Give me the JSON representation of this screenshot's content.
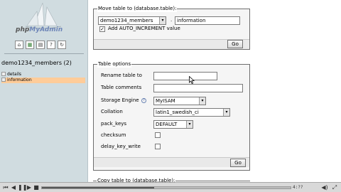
{
  "left_nav": {
    "logo_text_a": "php",
    "logo_text_b": "MyAdmin",
    "nav_icons": [
      "home-icon",
      "query-icon",
      "sql-icon",
      "docs-icon",
      "reload-icon"
    ],
    "database_title": "demo1234_members (2)",
    "tables": [
      {
        "name": "details",
        "selected": false
      },
      {
        "name": "information",
        "selected": true
      }
    ]
  },
  "move_table": {
    "legend": "Move table to (database.table):",
    "database_select": "demo1234_members",
    "separator": ".",
    "table_input": "information",
    "auto_increment_checked": true,
    "auto_increment_label": "Add AUTO_INCREMENT value",
    "go_label": "Go"
  },
  "table_options": {
    "legend": "Table options",
    "rename_label": "Rename table to",
    "rename_value": "",
    "comments_label": "Table comments",
    "comments_value": "",
    "storage_engine_label": "Storage Engine",
    "storage_engine_value": "MyISAM",
    "collation_label": "Collation",
    "collation_value": "latin1_swedish_ci",
    "pack_keys_label": "pack_keys",
    "pack_keys_value": "DEFAULT",
    "checksum_label": "checksum",
    "checksum_checked": false,
    "delay_key_write_label": "delay_key_write",
    "delay_key_write_checked": false,
    "go_label": "Go"
  },
  "copy_table": {
    "legend": "Copy table to (database.table):"
  },
  "player": {
    "progress": 0.45,
    "time": "4:??"
  },
  "colors": {
    "nav_bg": "#d0dce0",
    "selected_row": "#ffcc99",
    "fieldset_bg": "#f5f5f5"
  }
}
